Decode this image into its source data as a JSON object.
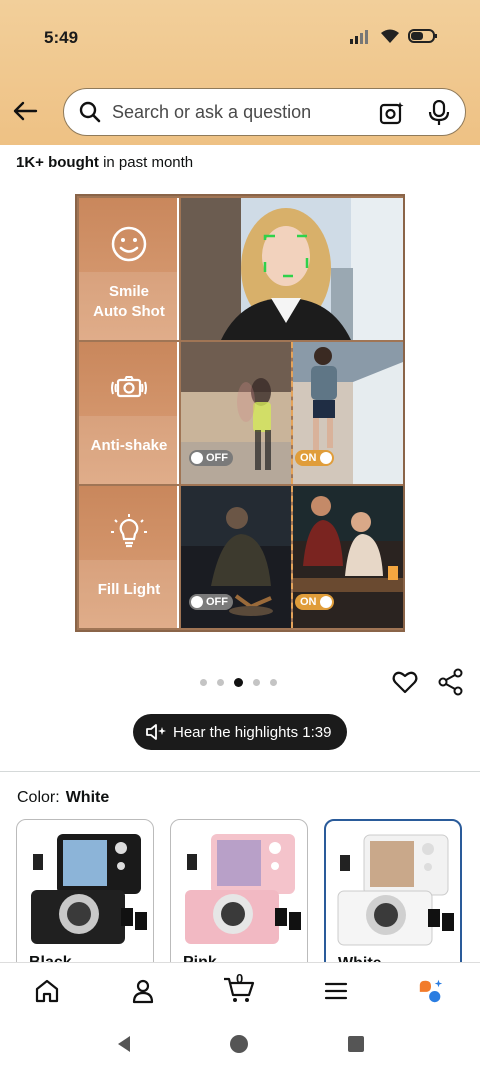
{
  "status_bar": {
    "time": "5:49"
  },
  "search": {
    "placeholder": "Search or ask a question"
  },
  "bought": {
    "bold": "1K+ bought",
    "rest": " in past month"
  },
  "product_image": {
    "rows": [
      {
        "label_lines": [
          "Smile",
          "Auto Shot"
        ],
        "icon": "smile-face-icon"
      },
      {
        "label_lines": [
          "Anti-shake"
        ],
        "icon": "camera-shake-icon",
        "off": "OFF",
        "on": "ON"
      },
      {
        "label_lines": [
          "Fill Light"
        ],
        "icon": "light-bulb-icon",
        "off": "OFF",
        "on": "ON"
      }
    ]
  },
  "pager": {
    "count": 5,
    "active": 2
  },
  "audio": {
    "label": "Hear the highlights 1:39"
  },
  "color": {
    "label": "Color:",
    "value": "White"
  },
  "swatches": [
    {
      "label": "Black"
    },
    {
      "label": "Pink"
    },
    {
      "label": "White"
    }
  ],
  "cart": {
    "count": "0"
  },
  "colors": {
    "header": "#eec184",
    "accent": "#e09d3a",
    "selected_border": "#2a5b9a"
  }
}
